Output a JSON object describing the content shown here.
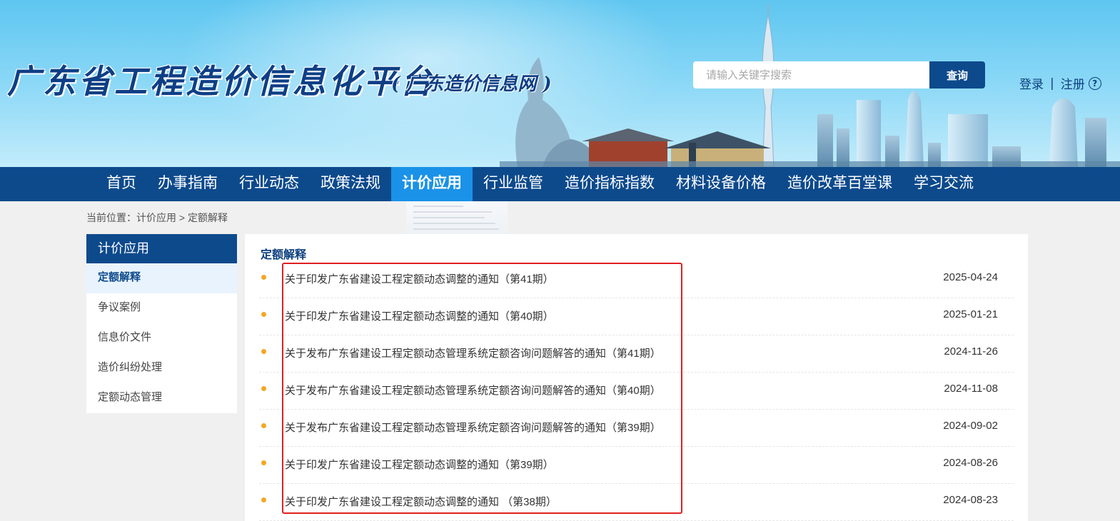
{
  "header": {
    "site_title": "广东省工程造价信息化平台",
    "site_subtitle": "( 广东造价信息网 )",
    "search": {
      "placeholder": "请输入关键字搜索",
      "button_label": "查询"
    },
    "user_links": {
      "login": "登录",
      "separator": "|",
      "register": "注册",
      "help_icon": "?"
    }
  },
  "nav": {
    "items": [
      "首页",
      "办事指南",
      "行业动态",
      "政策法规",
      "计价应用",
      "行业监管",
      "造价指标指数",
      "材料设备价格",
      "造价改革百堂课",
      "学习交流"
    ],
    "active": "计价应用"
  },
  "breadcrumb": "当前位置：计价应用 > 定额解释",
  "sidebar": {
    "heading": "计价应用",
    "items": [
      "定额解释",
      "争议案例",
      "信息价文件",
      "造价纠纷处理",
      "定额动态管理"
    ],
    "active": "定额解释"
  },
  "main": {
    "title": "定额解释",
    "list": [
      {
        "title": "关于印发广东省建设工程定额动态调整的通知（第41期）",
        "date": "2025-04-24"
      },
      {
        "title": "关于印发广东省建设工程定额动态调整的通知（第40期）",
        "date": "2025-01-21"
      },
      {
        "title": "关于发布广东省建设工程定额动态管理系统定额咨询问题解答的通知（第41期）",
        "date": "2024-11-26"
      },
      {
        "title": "关于发布广东省建设工程定额动态管理系统定额咨询问题解答的通知（第40期）",
        "date": "2024-11-08"
      },
      {
        "title": "关于发布广东省建设工程定额动态管理系统定额咨询问题解答的通知（第39期）",
        "date": "2024-09-02"
      },
      {
        "title": "关于印发广东省建设工程定额动态调整的通知（第39期）",
        "date": "2024-08-26"
      },
      {
        "title": "关于印发广东省建设工程定额动态调整的通知 （第38期）",
        "date": "2024-08-23"
      }
    ]
  },
  "colors": {
    "brand_blue": "#0d4a8c",
    "nav_active": "#1a92e8",
    "bullet": "#f5a623",
    "highlight_border": "#e02020"
  }
}
